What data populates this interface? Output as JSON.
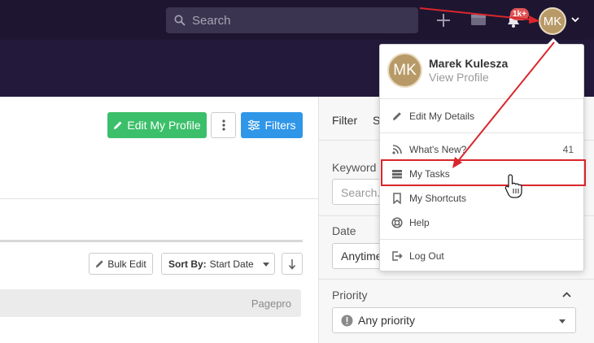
{
  "topbar": {
    "search_placeholder": "Search",
    "notification_badge": "1k+",
    "user_initials": "MK"
  },
  "main": {
    "edit_profile_label": "Edit My Profile",
    "filters_label": "Filters",
    "bulk_edit_label": "Bulk Edit",
    "sort_by_label": "Sort By:",
    "sort_by_value": "Start Date",
    "group_label": "Pagepro"
  },
  "filter_panel": {
    "tabs": [
      {
        "label": "Filter"
      },
      {
        "label": "S"
      }
    ],
    "keyword_label": "Keyword",
    "keyword_placeholder": "Search...",
    "date_label": "Date",
    "date_value": "Anytime",
    "priority_label": "Priority",
    "priority_value": "Any priority"
  },
  "user_menu": {
    "initials": "MK",
    "name": "Marek Kulesza",
    "view_profile": "View Profile",
    "items": [
      {
        "label": "Edit My Details",
        "icon": "pencil-icon"
      },
      {
        "label": "What's New?",
        "icon": "rss-icon",
        "count": "41"
      },
      {
        "label": "My Tasks",
        "icon": "tasks-icon"
      },
      {
        "label": "My Shortcuts",
        "icon": "bookmark-icon"
      },
      {
        "label": "Help",
        "icon": "lifebuoy-icon"
      },
      {
        "label": "Log Out",
        "icon": "logout-icon"
      }
    ]
  },
  "colors": {
    "topbar": "#1e1631",
    "subbar": "#231a3b",
    "edit_profile": "#3cbf6a",
    "filters": "#2f96e8",
    "annotation": "#d9262c",
    "avatar": "#b89a68"
  }
}
